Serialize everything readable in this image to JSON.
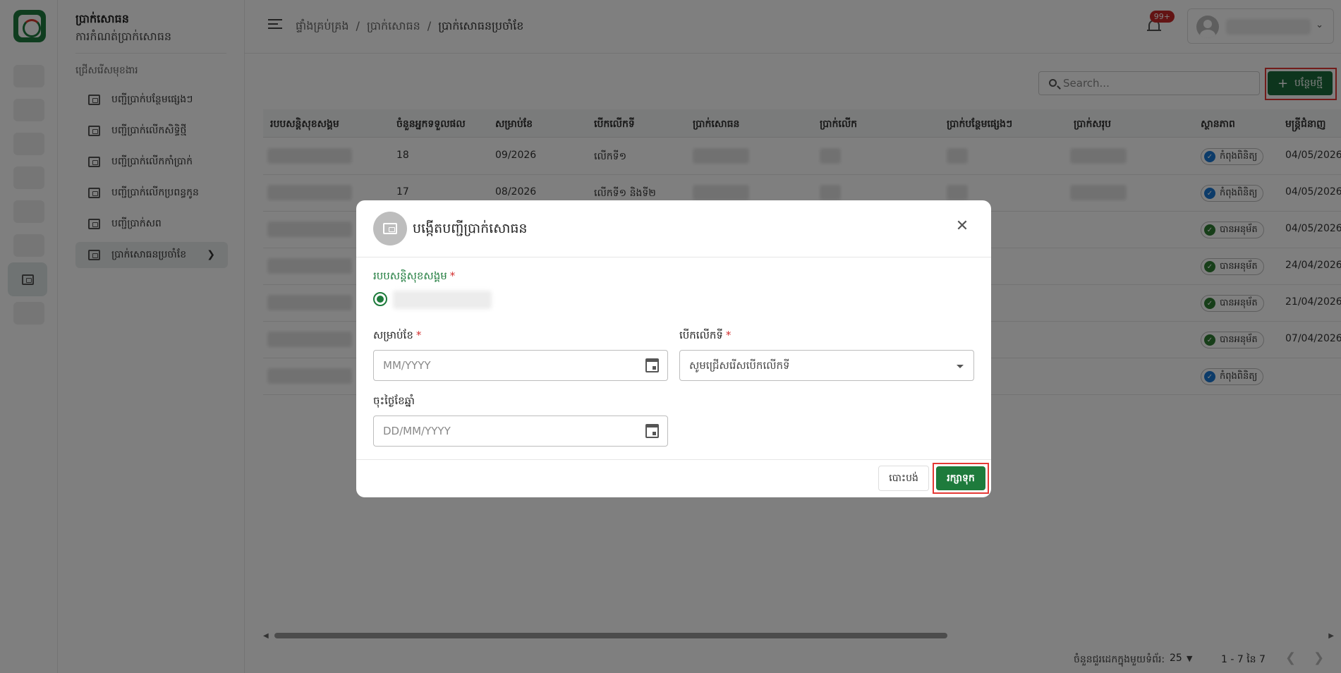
{
  "sidebar": {
    "title": "ប្រាក់សោធន",
    "subtitle": "ការកំណត់ប្រាក់សោធន",
    "section_label": "ជ្រើសរើសមុខងារ",
    "items": [
      {
        "label": "បញ្ជីប្រាក់បន្ថែមផ្សេងៗ",
        "active": false
      },
      {
        "label": "បញ្ជីប្រាក់លើកសិទ្ធិថ្មី",
        "active": false
      },
      {
        "label": "បញ្ជីប្រាក់លើកកាំប្រាក់",
        "active": false
      },
      {
        "label": "បញ្ជីប្រាក់លើកប្រពន្ធកូន",
        "active": false
      },
      {
        "label": "បញ្ជីប្រាក់សព",
        "active": false
      },
      {
        "label": "ប្រាក់សោធនប្រចាំខែ",
        "active": true
      }
    ]
  },
  "header": {
    "breadcrumb": [
      "ផ្ទាំងគ្រប់គ្រង",
      "ប្រាក់សោធន",
      "ប្រាក់សោធនប្រចាំខែ"
    ],
    "separator": "/",
    "notification_count": "99+"
  },
  "toolbar": {
    "search_placeholder": "Search...",
    "add_label": "បន្ថែមថ្មី"
  },
  "table": {
    "columns": [
      "របបសន្តិសុខសង្គម",
      "ចំនួនអ្នកទទួលផល",
      "សម្រាប់ខែ",
      "បើកលើកទី",
      "ប្រាក់សោធន",
      "ប្រាក់លើក",
      "ប្រាក់បន្ថែមផ្សេងៗ",
      "ប្រាក់សរុប",
      "ស្ថានភាព",
      "មន្ត្រីជំនាញ"
    ],
    "rows": [
      {
        "recipients": "18",
        "month": "09/2026",
        "round": "លើកទី១",
        "status": "កំពុងពិនិត្យ",
        "status_kind": "review",
        "date": "04/05/2026"
      },
      {
        "recipients": "17",
        "month": "08/2026",
        "round": "លើកទី១ និងទី២",
        "status": "កំពុងពិនិត្យ",
        "status_kind": "review",
        "date": "04/05/2026"
      },
      {
        "recipients": "",
        "month": "",
        "round": "",
        "status": "បានអនុម័ត",
        "status_kind": "approved",
        "date": "04/05/2026"
      },
      {
        "recipients": "",
        "month": "",
        "round": "",
        "status": "បានអនុម័ត",
        "status_kind": "approved",
        "date": "24/04/2026"
      },
      {
        "recipients": "",
        "month": "",
        "round": "",
        "status": "បានអនុម័ត",
        "status_kind": "approved",
        "date": "21/04/2026"
      },
      {
        "recipients": "",
        "month": "",
        "round": "",
        "status": "បានអនុម័ត",
        "status_kind": "approved",
        "date": "07/04/2026"
      },
      {
        "recipients": "",
        "month": "",
        "round": "",
        "status": "កំពុងពិនិត្យ",
        "status_kind": "review",
        "date": ""
      }
    ]
  },
  "pagination": {
    "rows_per_page_label": "ចំនួនជួរដេកក្នុងមួយទំព័រ:",
    "rows_per_page": "25",
    "range": "1 - 7 នៃ 7"
  },
  "dialog": {
    "title": "បង្កើតបញ្ជីប្រាក់សោធន",
    "scheme_label": "របបសន្តិសុខសង្គម",
    "month_label": "សម្រាប់ខែ",
    "month_placeholder": "MM/YYYY",
    "round_label": "បើកលើកទី",
    "round_placeholder": "សូមជ្រើសរើសបើកលើកទី",
    "date_label": "ចុះថ្ងៃខែឆ្នាំ",
    "date_placeholder": "DD/MM/YYYY",
    "required_mark": "*",
    "cancel_label": "បោះបង់",
    "save_label": "រក្សាទុក"
  },
  "colors": {
    "primary_green": "#1e7b3c",
    "add_button_green": "#1b6b3a",
    "highlight_red": "#e53935",
    "status_review": "#1976d2",
    "status_approved": "#2e7d32",
    "badge_red": "#c62828"
  },
  "icons": {
    "menu": "menu-collapse-icon",
    "notification": "bell-icon",
    "search": "search-icon",
    "add": "plus-icon",
    "close": "close-icon",
    "calendar": "calendar-icon",
    "wallet": "wallet-icon"
  }
}
